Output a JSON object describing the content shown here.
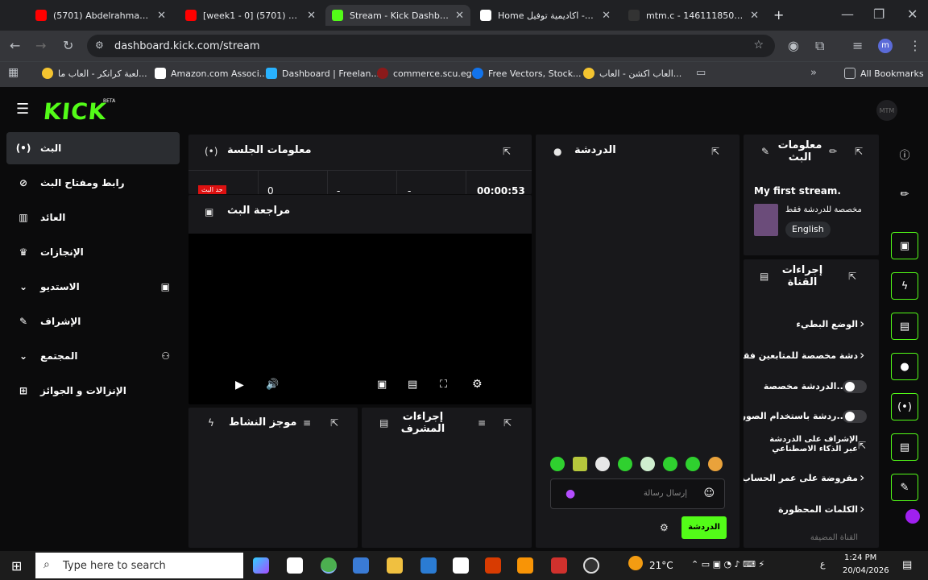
{
  "browser": {
    "tabs": [
      {
        "label": "(5701) Abdelrahman Gam",
        "color": "#ff0000"
      },
      {
        "label": "[week1 - 0] كورس (5701)",
        "color": "#ff0000"
      },
      {
        "label": "Stream - Kick Dashboard",
        "color": "#53fc18"
      },
      {
        "label": "Home اكاديمية توفيل - No",
        "color": "#ffffff"
      },
      {
        "label": "mtm.c - 146111850 [Cod",
        "color": "#333333"
      }
    ],
    "url": "dashboard.kick.com/stream",
    "profile": "m",
    "bookmarks": [
      "لعبة كرانكر - العاب ما...",
      "Amazon.com Associ...",
      "Dashboard | Freelan...",
      "commerce.scu.eg",
      "Free Vectors, Stock...",
      "العاب اكشن - العاب...",
      "",
      "All Bookmarks"
    ]
  },
  "brand": {
    "logo": "KICK",
    "beta": "BETA",
    "accent": "#53fc18",
    "avatar": "MTM"
  },
  "sidebar": {
    "items": [
      {
        "label": "البث",
        "icon": "broadcast-icon"
      },
      {
        "label": "رابط ومفتاح البث",
        "icon": "link-icon"
      },
      {
        "label": "العائد",
        "icon": "chart-icon"
      },
      {
        "label": "الإنجازات",
        "icon": "trophy-icon"
      },
      {
        "label": "الاستديو",
        "icon": "studio-icon"
      },
      {
        "label": "الإشراف",
        "icon": "wrench-icon"
      },
      {
        "label": "المجتمع",
        "icon": "community-icon"
      },
      {
        "label": "الإنزالات و الجوائز",
        "icon": "gift-icon"
      }
    ]
  },
  "session": {
    "title": "معلومات الجلسة",
    "badge": "حد البث",
    "cells": [
      "0",
      "-",
      "-",
      "00:00:53"
    ]
  },
  "preview": {
    "title": "مراجعة البث"
  },
  "activity": {
    "title": "موجز النشاط"
  },
  "modactions": {
    "title": "إجراءات المشرف"
  },
  "chat": {
    "title": "الدردشة",
    "placeholder": "إرسال رسالة",
    "send": "الدردشة"
  },
  "streaminfo": {
    "title": "معلومات البث",
    "stream_title": "My first stream.",
    "category": "مخصصة للدردشة فقط",
    "language": "English"
  },
  "channelactions": {
    "title": "إجراءات القناة",
    "items": [
      "الوضع البطيء",
      "دشة مخصصة للمتابعين فقط",
      "...الدردشة مخصصة",
      "...ردشة باستخدام الصور",
      "الإشراف على الدردشة عبر الذكاء الاصطناعي",
      "مفروضة على عمر الحساب",
      "الكلمات المحظورة",
      "القناة المضيفة"
    ]
  },
  "taskbar": {
    "search": "Type here to search",
    "weather": "21°C",
    "time": "1:24 PM",
    "date": "20/04/2026"
  }
}
